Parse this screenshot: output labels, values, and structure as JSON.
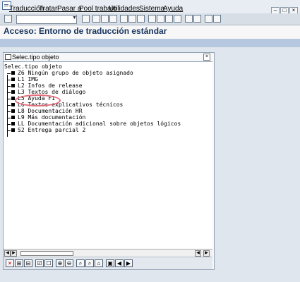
{
  "menu": [
    {
      "label": "Traducción"
    },
    {
      "label": "Tratar"
    },
    {
      "label": "Pasar a"
    },
    {
      "label": "Pool trabajo"
    },
    {
      "label": "Utilidades"
    },
    {
      "label": "Sistema"
    },
    {
      "label": "Ayuda"
    }
  ],
  "title": "Acceso: Entorno de traducción estándar",
  "dialog": {
    "title": "Selec.tipo objeto",
    "tree_header": "Selec.tipo objeto",
    "items": [
      {
        "code": "Z6",
        "label": "Ningún grupo de objeto asignado"
      },
      {
        "code": "L1",
        "label": "IMG"
      },
      {
        "code": "L2",
        "label": "Infos de release"
      },
      {
        "code": "L3",
        "label": "Textos de diálogo"
      },
      {
        "code": "L5",
        "label": "Ayuda F1"
      },
      {
        "code": "L6",
        "label": "Textos explicativos técnicos"
      },
      {
        "code": "L8",
        "label": "Documentación HR"
      },
      {
        "code": "L9",
        "label": "Más documentación"
      },
      {
        "code": "LL",
        "label": "Documentación adicional sobre objetos lógicos"
      },
      {
        "code": "S2",
        "label": "Entrega parcial 2"
      }
    ]
  },
  "status": {
    "highlighted": "L5 Ayuda F1"
  }
}
